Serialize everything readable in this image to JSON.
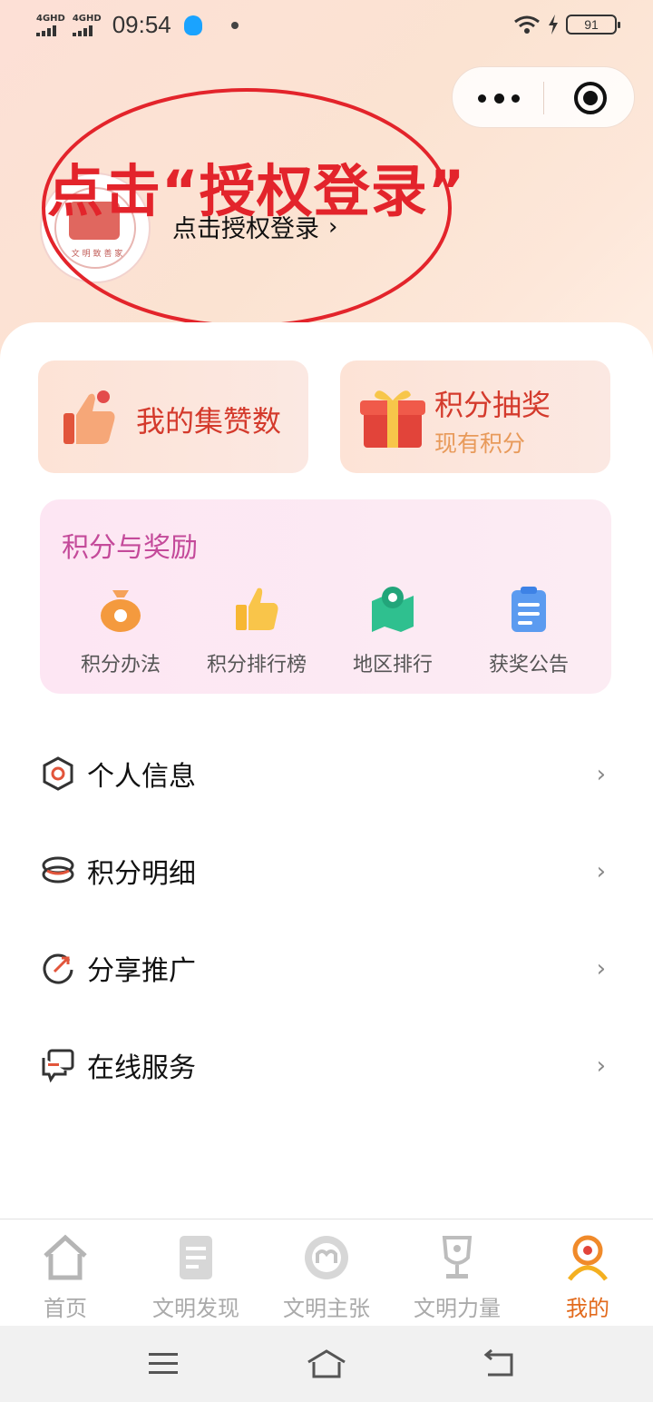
{
  "status_bar": {
    "network_1": "4GHD",
    "network_2": "4GHD",
    "time": "09:54",
    "battery": "91"
  },
  "capsule": {
    "more_icon": "more-dots-icon",
    "close_icon": "target-circle-icon"
  },
  "profile": {
    "annotation_text": "点击“授权登录”",
    "login_label": "点击授权登录",
    "login_chevron": "›",
    "avatar_text": "文 明 致 善 家"
  },
  "tiles": {
    "likes_label": "我的集赞数",
    "lottery_label": "积分抽奖",
    "lottery_sub": "现有积分"
  },
  "rewards": {
    "title": "积分与奖励",
    "items": [
      {
        "label": "积分办法",
        "icon": "money-bag-icon"
      },
      {
        "label": "积分排行榜",
        "icon": "thumbs-up-icon"
      },
      {
        "label": "地区排行",
        "icon": "map-pin-icon"
      },
      {
        "label": "获奖公告",
        "icon": "clipboard-icon"
      }
    ]
  },
  "menu": [
    {
      "label": "个人信息",
      "icon": "hexagon-user-icon"
    },
    {
      "label": "积分明细",
      "icon": "coins-icon"
    },
    {
      "label": "分享推广",
      "icon": "share-arrow-icon"
    },
    {
      "label": "在线服务",
      "icon": "chat-bubbles-icon"
    }
  ],
  "tabbar": {
    "tabs": [
      {
        "label": "首页",
        "icon": "home-icon"
      },
      {
        "label": "文明发现",
        "icon": "document-icon"
      },
      {
        "label": "文明主张",
        "icon": "circle-m-icon"
      },
      {
        "label": "文明力量",
        "icon": "trophy-icon"
      },
      {
        "label": "我的",
        "icon": "person-icon"
      }
    ],
    "active_color": "#e26a1c",
    "inactive_color": "#aaaaaa"
  },
  "colors": {
    "annotation_red": "#e3242b",
    "tile_text_red": "#d43a2c",
    "rewards_title": "#c44a9a"
  }
}
